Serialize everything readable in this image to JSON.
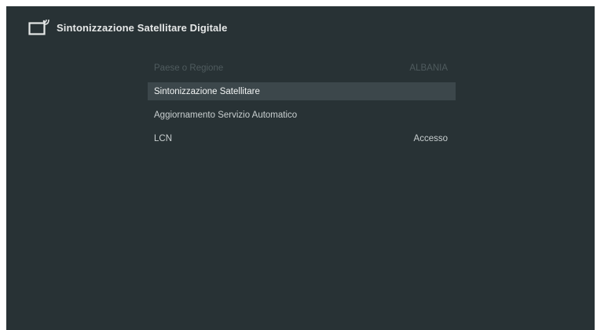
{
  "header": {
    "title": "Sintonizzazione Satellitare Digitale",
    "icon": "satellite-tv-icon"
  },
  "menu": {
    "items": [
      {
        "label": "Paese o Regione",
        "value": "ALBANIA",
        "state": "disabled"
      },
      {
        "label": "Sintonizzazione Satellitare",
        "value": "",
        "state": "selected"
      },
      {
        "label": "Aggiornamento Servizio Automatico",
        "value": "",
        "state": "normal"
      },
      {
        "label": "LCN",
        "value": "Accesso",
        "state": "normal"
      }
    ]
  },
  "colors": {
    "background": "#283235",
    "selected_row": "#3c474b",
    "text": "#c9cfd0",
    "disabled_text": "#4f5b5e"
  }
}
